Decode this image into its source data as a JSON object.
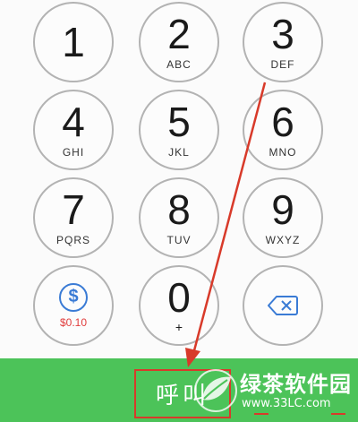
{
  "dialpad": {
    "keys": [
      {
        "digit": "1",
        "letters": ""
      },
      {
        "digit": "2",
        "letters": "ABC"
      },
      {
        "digit": "3",
        "letters": "DEF"
      },
      {
        "digit": "4",
        "letters": "GHI"
      },
      {
        "digit": "5",
        "letters": "JKL"
      },
      {
        "digit": "6",
        "letters": "MNO"
      },
      {
        "digit": "7",
        "letters": "PQRS"
      },
      {
        "digit": "8",
        "letters": "TUV"
      },
      {
        "digit": "9",
        "letters": "WXYZ"
      },
      {
        "digit": "0",
        "letters": "+"
      }
    ],
    "credit": {
      "symbol": "$",
      "amount": "$0.10"
    },
    "delete_icon": "backspace-icon"
  },
  "call_bar": {
    "label": "呼叫"
  },
  "watermark": {
    "title": "绿茶软件园",
    "url": "www.33LC.com"
  },
  "colors": {
    "call_bar": "#4cc359",
    "key_border": "#b3b3b3",
    "accent_blue": "#3a7bd5",
    "price_red": "#e03c3c",
    "annotation_red": "#d83a2a"
  }
}
